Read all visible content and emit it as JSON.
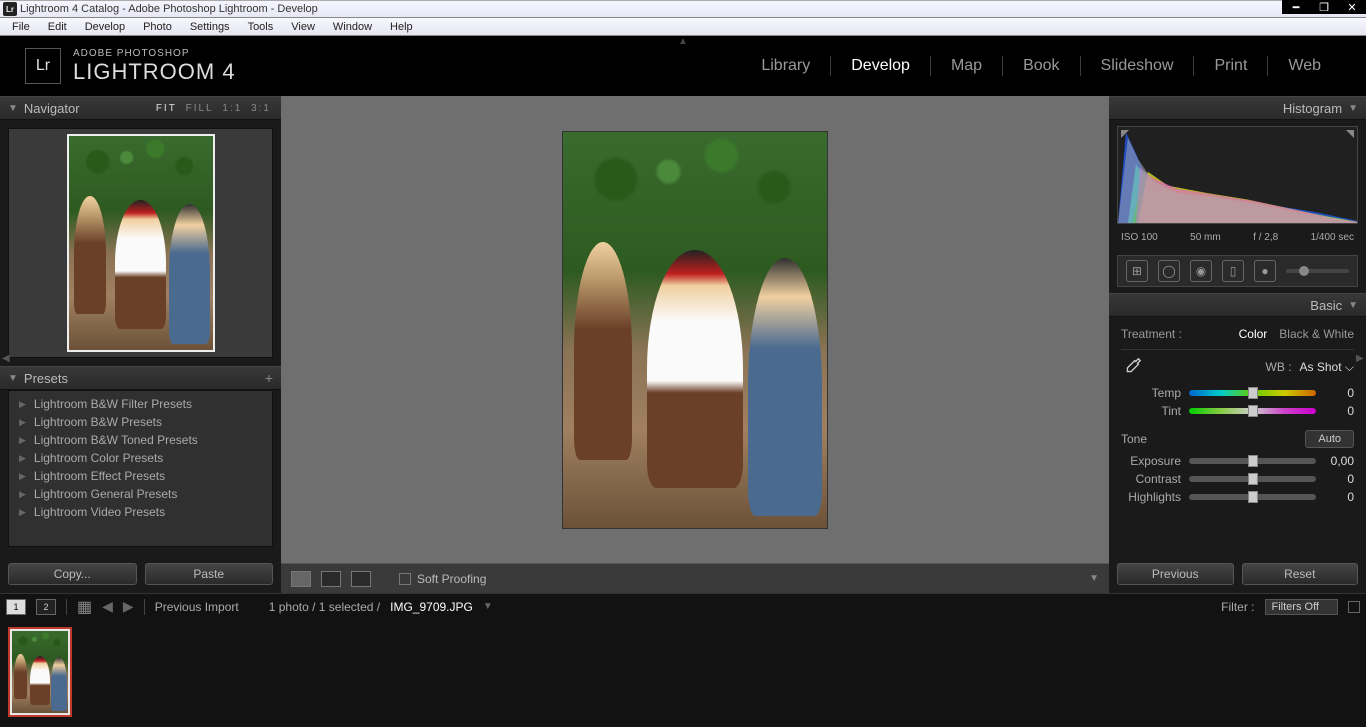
{
  "titlebar": {
    "title": "Lightroom 4 Catalog - Adobe Photoshop Lightroom - Develop"
  },
  "menubar": {
    "items": [
      "File",
      "Edit",
      "Develop",
      "Photo",
      "Settings",
      "Tools",
      "View",
      "Window",
      "Help"
    ]
  },
  "logo": {
    "mark": "Lr",
    "small": "ADOBE PHOTOSHOP",
    "large": "LIGHTROOM 4"
  },
  "modules": {
    "items": [
      "Library",
      "Develop",
      "Map",
      "Book",
      "Slideshow",
      "Print",
      "Web"
    ],
    "active": "Develop",
    "circled": "Develop"
  },
  "left": {
    "navigator": {
      "title": "Navigator",
      "zooms": [
        "FIT",
        "FILL",
        "1:1",
        "3:1"
      ],
      "active": "FIT"
    },
    "presets": {
      "title": "Presets",
      "items": [
        "Lightroom B&W Filter Presets",
        "Lightroom B&W Presets",
        "Lightroom B&W Toned Presets",
        "Lightroom Color Presets",
        "Lightroom Effect Presets",
        "Lightroom General Presets",
        "Lightroom Video Presets"
      ]
    },
    "buttons": {
      "copy": "Copy...",
      "paste": "Paste"
    }
  },
  "center": {
    "soft_proof": "Soft Proofing"
  },
  "right": {
    "histogram": {
      "title": "Histogram",
      "iso": "ISO 100",
      "focal": "50 mm",
      "aperture": "f / 2,8",
      "shutter": "1/400 sec"
    },
    "basic": {
      "title": "Basic",
      "treatment_label": "Treatment :",
      "color": "Color",
      "bw": "Black & White",
      "wb_label": "WB :",
      "wb_value": "As Shot ⌵",
      "temp": {
        "label": "Temp",
        "value": "0"
      },
      "tint": {
        "label": "Tint",
        "value": "0"
      },
      "tone": {
        "label": "Tone",
        "auto": "Auto"
      },
      "exposure": {
        "label": "Exposure",
        "value": "0,00"
      },
      "contrast": {
        "label": "Contrast",
        "value": "0"
      },
      "highlights": {
        "label": "Highlights",
        "value": "0"
      }
    },
    "buttons": {
      "previous": "Previous",
      "reset": "Reset"
    }
  },
  "bottombar": {
    "view1": "1",
    "view2": "2",
    "source": "Previous Import",
    "count": "1 photo / 1 selected /",
    "file": "IMG_9709.JPG",
    "filter_label": "Filter :",
    "filter_value": "Filters Off"
  }
}
